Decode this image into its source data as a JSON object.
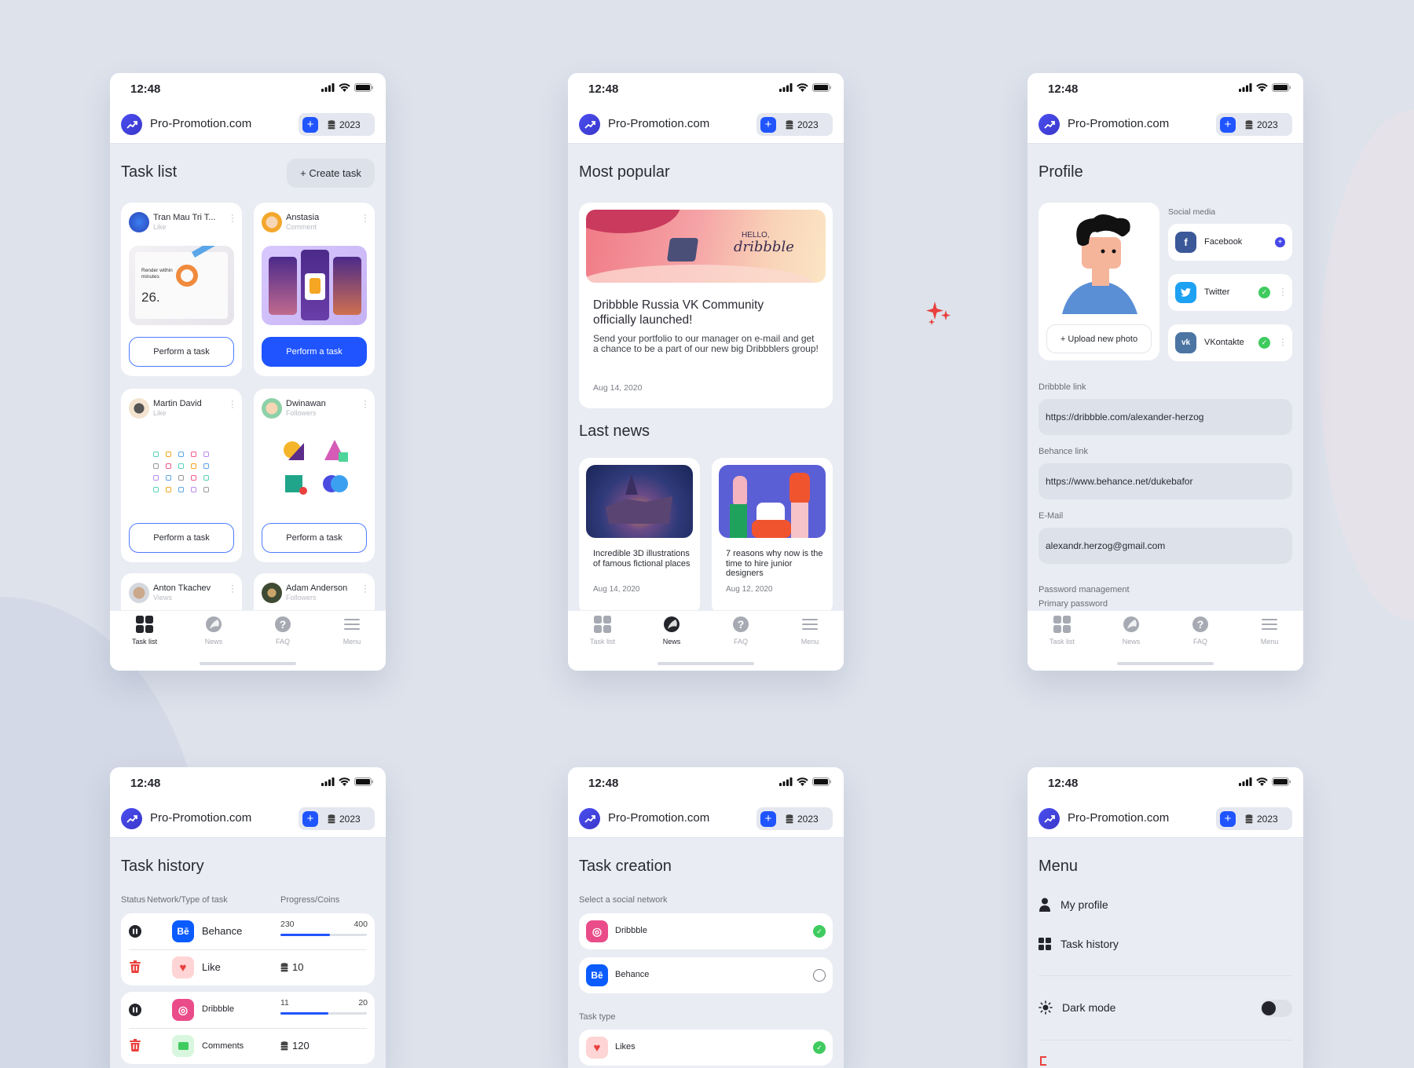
{
  "app": {
    "time": "12:48",
    "brand": "Pro-Promotion.com",
    "coins": "2023",
    "colors": {
      "accent": "#1f54ff",
      "logo": "#3d3ad8",
      "background": "#dde2eb",
      "success": "#3fcb5f",
      "danger": "#e8413e"
    }
  },
  "tabs": [
    {
      "label": "Task list",
      "icon": "grid-icon"
    },
    {
      "label": "News",
      "icon": "globe-icon"
    },
    {
      "label": "FAQ",
      "icon": "question-icon"
    },
    {
      "label": "Menu",
      "icon": "menu-icon"
    }
  ],
  "task_list": {
    "title": "Task list",
    "create_label": "+ Create task",
    "cards": [
      {
        "name": "Tran Mau Tri T...",
        "type": "Like",
        "button": "Perform a task",
        "active": false
      },
      {
        "name": "Anstasia",
        "type": "Comment",
        "button": "Perform a task",
        "active": true
      },
      {
        "name": "Martin David",
        "type": "Like",
        "button": "Perform a task",
        "active": false
      },
      {
        "name": "Dwinawan",
        "type": "Followers",
        "button": "Perform a task",
        "active": false
      },
      {
        "name": "Anton Tkachev",
        "type": "Views"
      },
      {
        "name": "Adam Anderson",
        "type": "Followers"
      }
    ],
    "image_text": {
      "render": "Render within minutes",
      "number": "26."
    }
  },
  "news": {
    "popular_title": "Most popular",
    "banner_text": {
      "hello": "HELLO,",
      "logo": "dribbble"
    },
    "featured": {
      "title": "Dribbble Russia VK Community officially launched!",
      "body": "Send your portfolio to our manager on e-mail and get a chance to be a part of our new big Dribbblers group!",
      "date": "Aug 14, 2020"
    },
    "last_title": "Last news",
    "items": [
      {
        "title": "Incredible 3D illustrations of famous fictional places",
        "date": "Aug 14, 2020"
      },
      {
        "title": "7 reasons why now is the time to hire junior designers",
        "date": "Aug 12, 2020"
      }
    ]
  },
  "profile": {
    "title": "Profile",
    "upload_label": "+ Upload new photo",
    "social_label": "Social media",
    "social": [
      {
        "name": "Facebook",
        "glyph": "f",
        "color": "#3b5998",
        "status": "add"
      },
      {
        "name": "Twitter",
        "glyph": "t",
        "color": "#1da1f2",
        "status": "connected"
      },
      {
        "name": "VKontakte",
        "glyph": "vk",
        "color": "#4c75a3",
        "status": "connected"
      }
    ],
    "fields": [
      {
        "label": "Dribbble link",
        "value": "https://dribbble.com/alexander-herzog"
      },
      {
        "label": "Behance link",
        "value": "https://www.behance.net/dukebafor"
      },
      {
        "label": "E-Mail",
        "value": "alexandr.herzog@gmail.com"
      }
    ],
    "password_label": "Password management",
    "primary_password_label": "Primary password"
  },
  "task_history": {
    "title": "Task history",
    "columns": [
      "Status",
      "Network/Type of task",
      "Progress/Coins"
    ],
    "groups": [
      {
        "network": "Behance",
        "network_glyph": "Bē",
        "progress": 230,
        "max": 400,
        "progress_label": "230",
        "max_label": "400",
        "type": "Like",
        "coins": "10",
        "status": "paused"
      },
      {
        "network": "Dribbble",
        "network_glyph": "◎",
        "progress": 11,
        "max": 20,
        "progress_label": "11",
        "max_label": "20",
        "type": "Comments",
        "coins": "120",
        "status": "paused"
      }
    ]
  },
  "task_creation": {
    "title": "Task creation",
    "network_label": "Select a social network",
    "networks": [
      {
        "name": "Dribbble",
        "selected": true
      },
      {
        "name": "Behance",
        "glyph": "Bē",
        "selected": false
      }
    ],
    "type_label": "Task type",
    "types": [
      {
        "name": "Likes",
        "selected": true
      }
    ]
  },
  "menu": {
    "title": "Menu",
    "items": [
      {
        "label": "My profile",
        "icon": "user-icon"
      },
      {
        "label": "Task history",
        "icon": "grid-icon"
      }
    ],
    "dark_mode_label": "Dark mode",
    "dark_mode_on": false
  }
}
